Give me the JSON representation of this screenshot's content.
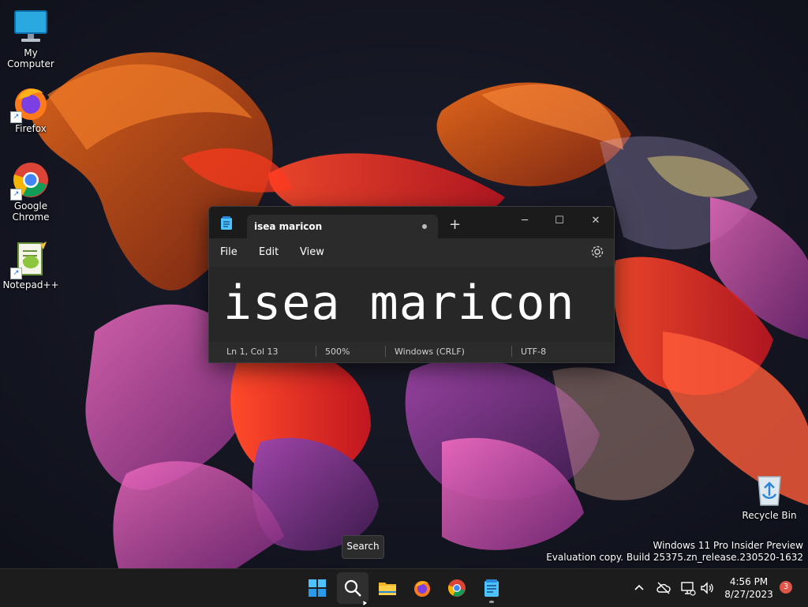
{
  "desktop": {
    "icons": [
      {
        "label": "My Computer"
      },
      {
        "label": "Firefox"
      },
      {
        "label": "Google Chrome"
      },
      {
        "label": "Notepad++"
      },
      {
        "label": "Recycle Bin"
      }
    ]
  },
  "notepad": {
    "tab_title": "isea maricon",
    "new_tab": "+",
    "menu": [
      "File",
      "Edit",
      "View"
    ],
    "content": "isea maricon",
    "status": {
      "position": "Ln 1, Col 13",
      "zoom": "500%",
      "line_ending": "Windows (CRLF)",
      "encoding": "UTF-8"
    },
    "caption": {
      "minimize": "─",
      "maximize": "☐",
      "close": "✕"
    }
  },
  "tooltip": {
    "text": "Search"
  },
  "watermark": {
    "line1": "Windows 11 Pro Insider Preview",
    "line2": "Evaluation copy. Build 25375.zn_release.230520-1632"
  },
  "taskbar": {
    "apps": [
      "start-icon",
      "search-icon",
      "file-explorer-icon",
      "firefox-icon",
      "chrome-icon",
      "notepad-icon"
    ],
    "clock": {
      "time": "4:56 PM",
      "date": "8/27/2023"
    },
    "notification_count": "3"
  },
  "colors": {
    "accent": "#0078d4",
    "taskbar": "#1c1c1c",
    "window": "#202020"
  }
}
